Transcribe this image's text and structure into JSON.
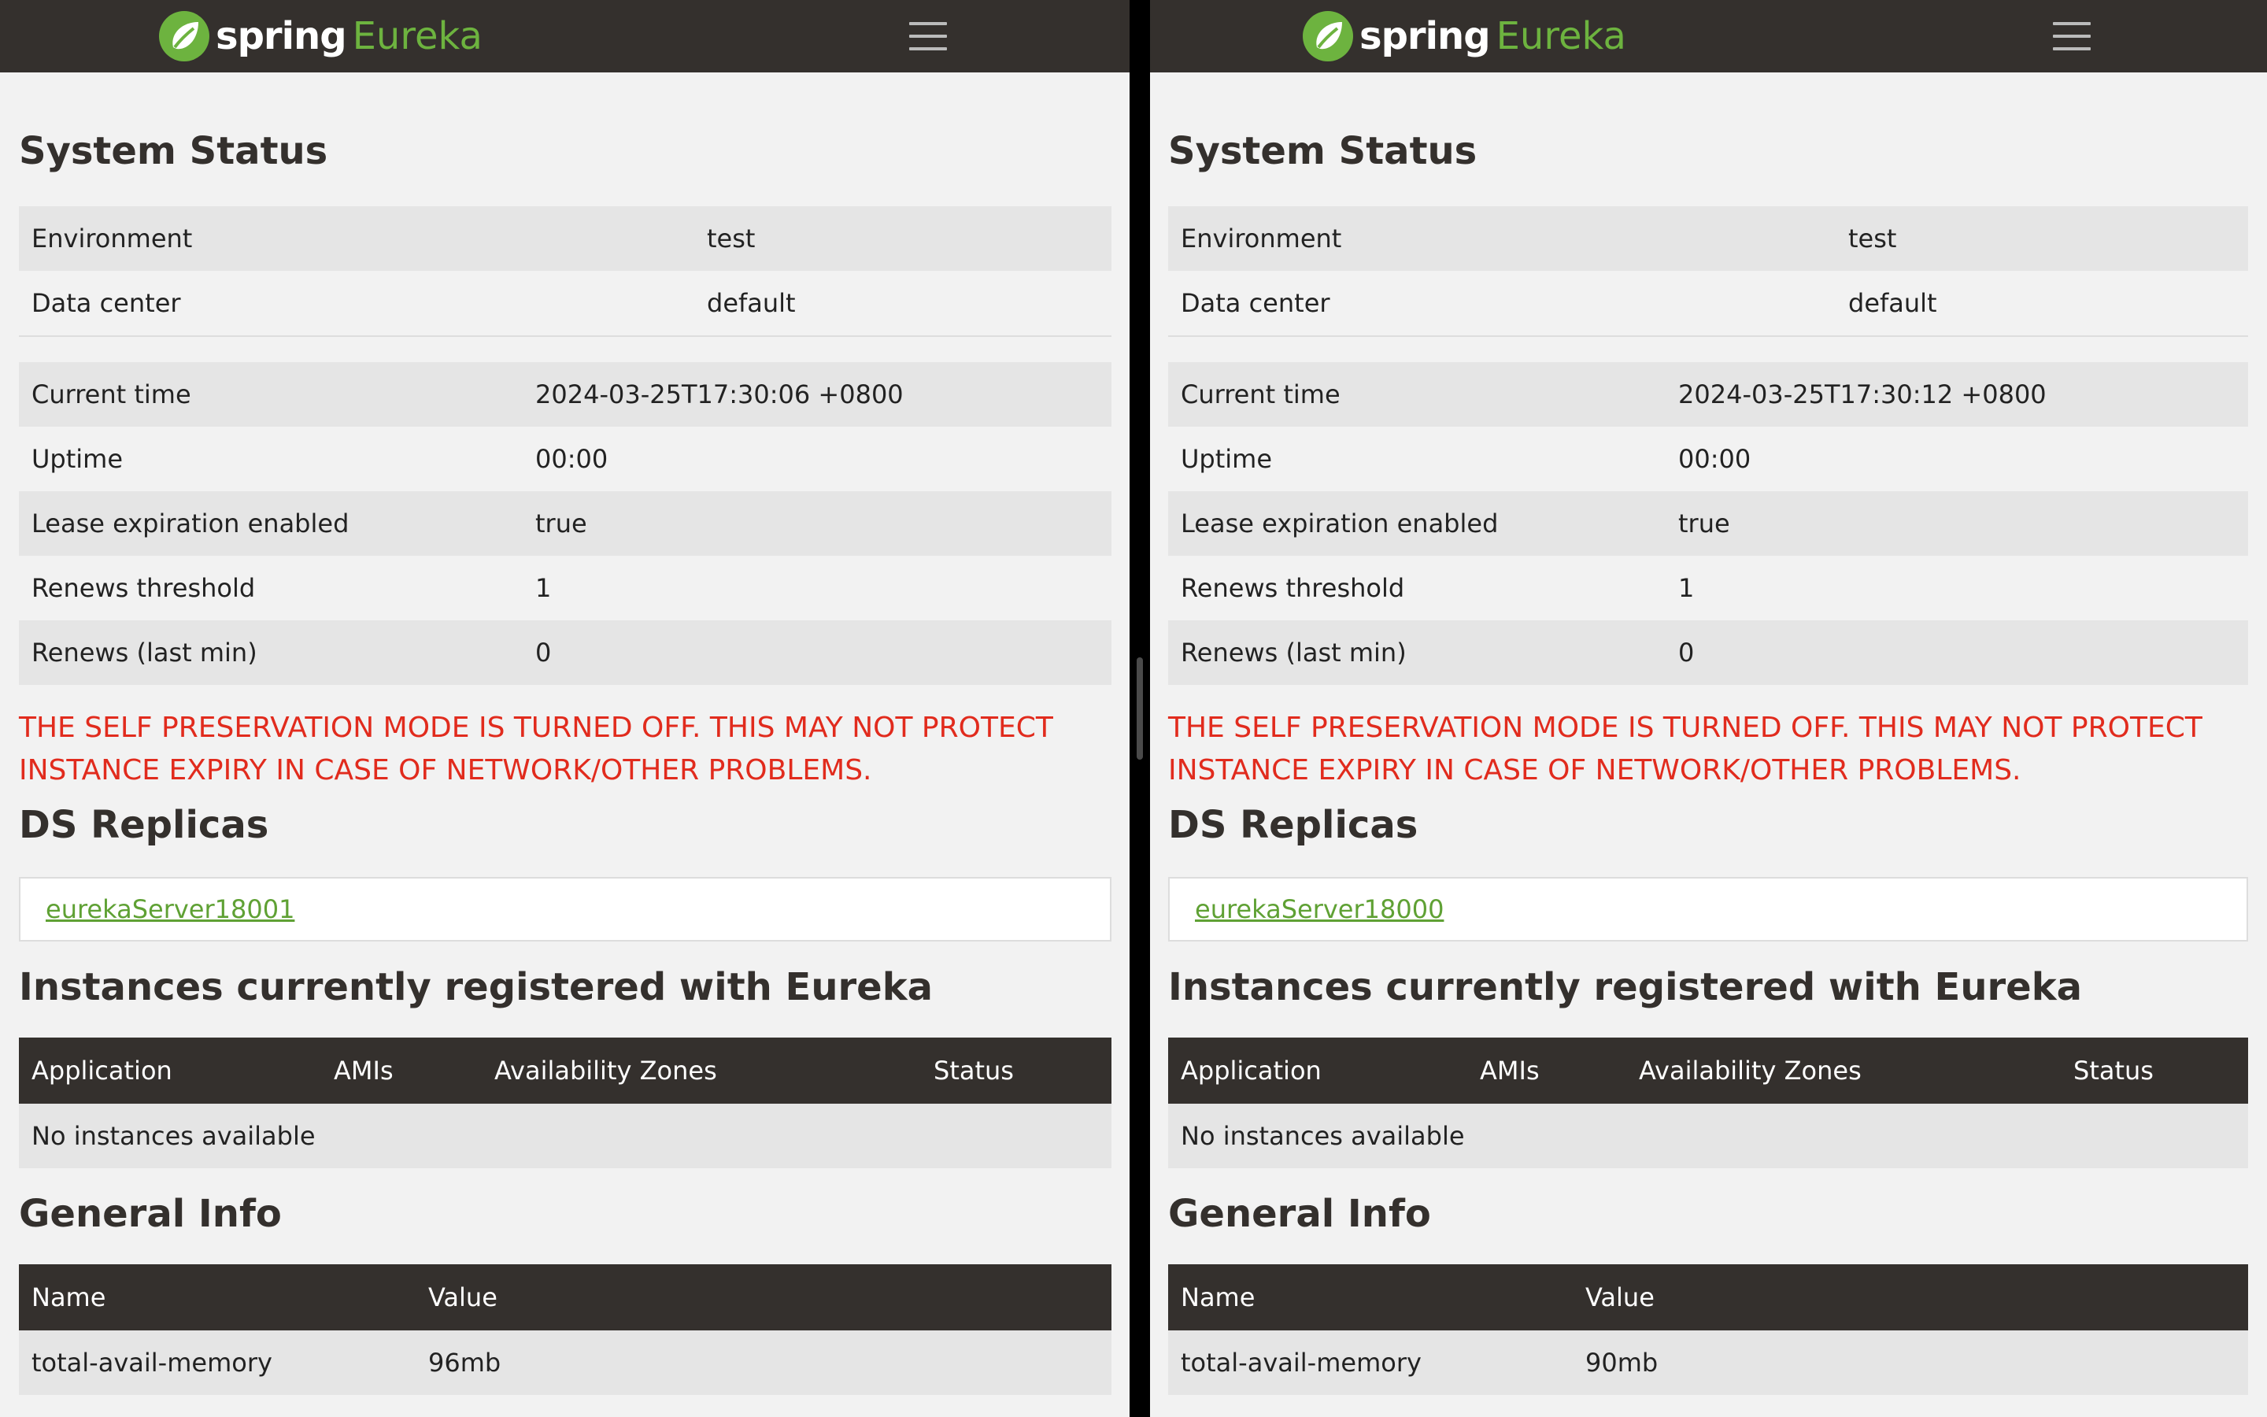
{
  "brand": {
    "spring": "spring",
    "eureka": "Eureka"
  },
  "colors": {
    "navbar": "#34302d",
    "accent": "#6db33f",
    "warning": "#e12b1d",
    "link": "#5fa134"
  },
  "icons": {
    "logo": "spring-leaf-icon",
    "menu": "hamburger-menu-icon"
  },
  "panes": [
    {
      "system_status": {
        "title": "System Status",
        "env_rows": [
          {
            "label": "Environment",
            "value": "test"
          },
          {
            "label": "Data center",
            "value": "default"
          }
        ],
        "rows": [
          {
            "label": "Current time",
            "value": "2024-03-25T17:30:06 +0800"
          },
          {
            "label": "Uptime",
            "value": "00:00"
          },
          {
            "label": "Lease expiration enabled",
            "value": "true"
          },
          {
            "label": "Renews threshold",
            "value": "1"
          },
          {
            "label": "Renews (last min)",
            "value": "0"
          }
        ]
      },
      "warning": "THE SELF PRESERVATION MODE IS TURNED OFF. THIS MAY NOT PROTECT INSTANCE EXPIRY IN CASE OF NETWORK/OTHER PROBLEMS.",
      "replicas": {
        "title": "DS Replicas",
        "link": "eurekaServer18001"
      },
      "instances": {
        "title": "Instances currently registered with Eureka",
        "headers": [
          "Application",
          "AMIs",
          "Availability Zones",
          "Status"
        ],
        "empty": "No instances available"
      },
      "general_info": {
        "title": "General Info",
        "headers": [
          "Name",
          "Value"
        ],
        "rows": [
          {
            "name": "total-avail-memory",
            "value": "96mb"
          }
        ]
      }
    },
    {
      "system_status": {
        "title": "System Status",
        "env_rows": [
          {
            "label": "Environment",
            "value": "test"
          },
          {
            "label": "Data center",
            "value": "default"
          }
        ],
        "rows": [
          {
            "label": "Current time",
            "value": "2024-03-25T17:30:12 +0800"
          },
          {
            "label": "Uptime",
            "value": "00:00"
          },
          {
            "label": "Lease expiration enabled",
            "value": "true"
          },
          {
            "label": "Renews threshold",
            "value": "1"
          },
          {
            "label": "Renews (last min)",
            "value": "0"
          }
        ]
      },
      "warning": "THE SELF PRESERVATION MODE IS TURNED OFF. THIS MAY NOT PROTECT INSTANCE EXPIRY IN CASE OF NETWORK/OTHER PROBLEMS.",
      "replicas": {
        "title": "DS Replicas",
        "link": "eurekaServer18000"
      },
      "instances": {
        "title": "Instances currently registered with Eureka",
        "headers": [
          "Application",
          "AMIs",
          "Availability Zones",
          "Status"
        ],
        "empty": "No instances available"
      },
      "general_info": {
        "title": "General Info",
        "headers": [
          "Name",
          "Value"
        ],
        "rows": [
          {
            "name": "total-avail-memory",
            "value": "90mb"
          }
        ]
      }
    }
  ]
}
